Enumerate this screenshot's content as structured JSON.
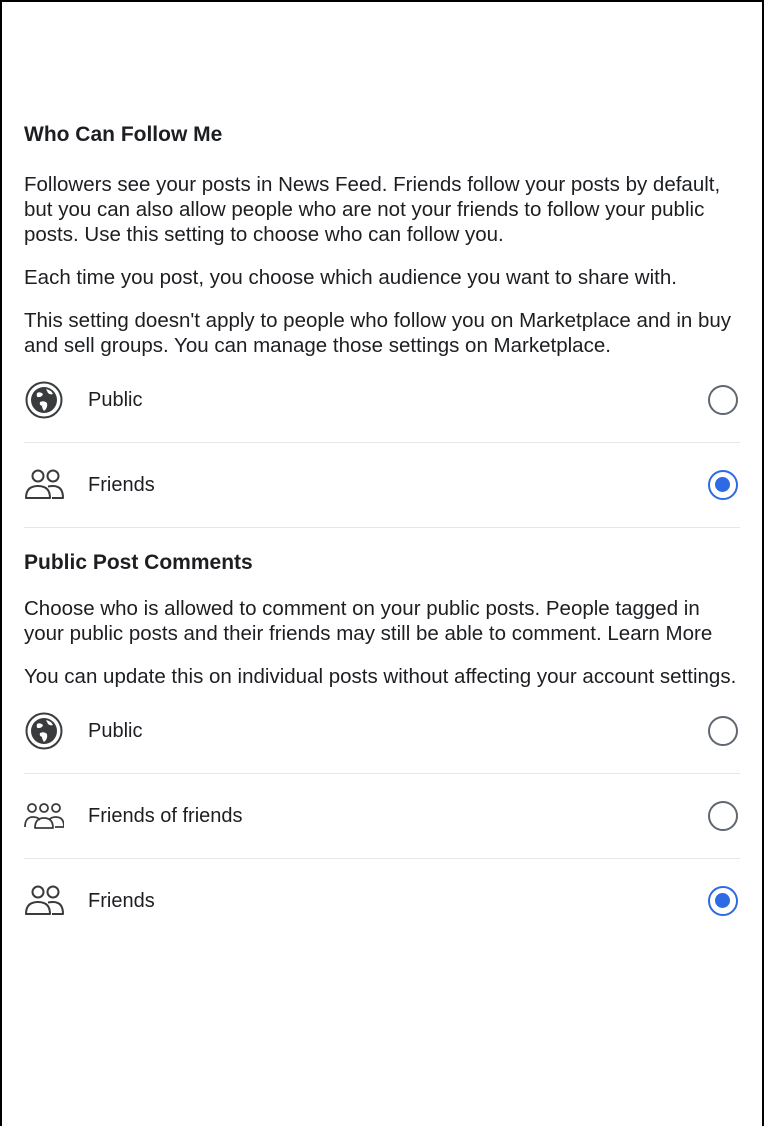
{
  "follow_section": {
    "title": "Who Can Follow Me",
    "paragraph_1": "Followers see your posts in News Feed. Friends follow your posts by default, but you can also allow people who are not your friends to follow your public posts. Use this setting to choose who can follow you.",
    "paragraph_2": "Each time you post, you choose which audience you want to share with.",
    "paragraph_3": "This setting doesn't apply to people who follow you on Marketplace and in buy and sell groups. You can manage those settings on Marketplace.",
    "options": [
      {
        "label": "Public",
        "icon": "globe-icon",
        "selected": false
      },
      {
        "label": "Friends",
        "icon": "friends-icon",
        "selected": true
      }
    ]
  },
  "comments_section": {
    "title": "Public Post Comments",
    "paragraph_1": "Choose who is allowed to comment on your public posts. People tagged in your public posts and their friends may still be able to comment. Learn More",
    "paragraph_2": "You can update this on individual posts without affecting your account settings.",
    "options": [
      {
        "label": "Public",
        "icon": "globe-icon",
        "selected": false
      },
      {
        "label": "Friends of friends",
        "icon": "friends-of-friends-icon",
        "selected": false
      },
      {
        "label": "Friends",
        "icon": "friends-icon",
        "selected": true
      }
    ]
  },
  "colors": {
    "accent": "#2d6ae3",
    "text": "#1c1e21",
    "divider": "#e4e6ea"
  }
}
